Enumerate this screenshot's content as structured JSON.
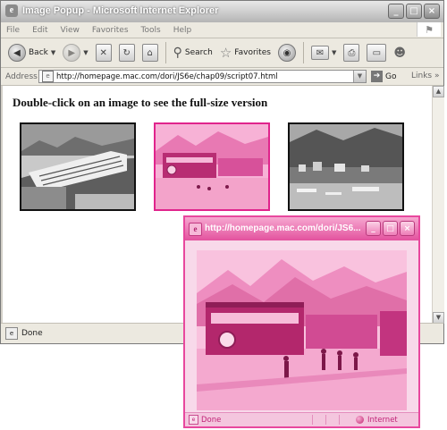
{
  "window": {
    "title": "Image Popup - Microsoft Internet Explorer",
    "controls": {
      "minimize": "_",
      "maximize": "□",
      "close": "×"
    }
  },
  "menu": [
    "File",
    "Edit",
    "View",
    "Favorites",
    "Tools",
    "Help"
  ],
  "toolbar": {
    "back_label": "Back",
    "search_label": "Search",
    "favorites_label": "Favorites"
  },
  "address": {
    "label": "Address",
    "url": "http://homepage.mac.com/dori/JS6e/chap09/script07.html",
    "go_label": "Go",
    "links_label": "Links"
  },
  "page": {
    "heading": "Double-click on an image to see the full-size version"
  },
  "status": {
    "text": "Done"
  },
  "popup": {
    "title": "http://homepage.mac.com/dori/JS6...",
    "status_left": "Done",
    "status_zone": "Internet"
  },
  "colors": {
    "highlight": "#e0248c",
    "popup_tint": "#f8d9ea"
  }
}
